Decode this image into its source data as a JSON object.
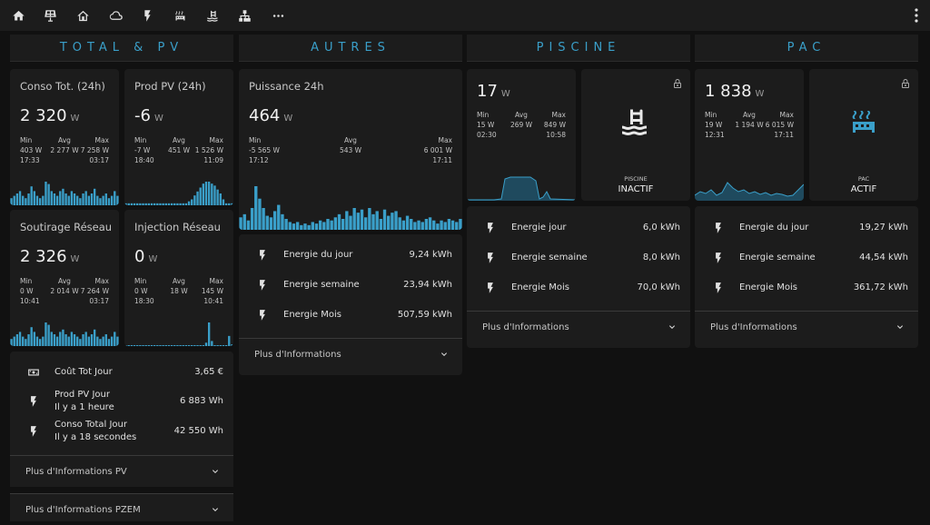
{
  "nav": {
    "icons": [
      "home-icon",
      "solar-panel-icon",
      "home-outline-icon",
      "cloud-icon",
      "flash-icon",
      "heat-pump-icon",
      "pool-icon",
      "network-icon",
      "more-icon"
    ]
  },
  "columns": [
    {
      "title": "TOTAL & PV"
    },
    {
      "title": "AUTRES"
    },
    {
      "title": "PISCINE"
    },
    {
      "title": "PAC"
    }
  ],
  "sensors": {
    "conso_tot": {
      "name": "Conso Tot. (24h)",
      "value": "2 320",
      "unit": "W",
      "min_label": "Min",
      "avg_label": "Avg",
      "max_label": "Max",
      "min": "403 W",
      "avg": "2 277 W",
      "max": "7 258 W",
      "min_time": "17:33",
      "max_time": "03:17"
    },
    "prod_pv": {
      "name": "Prod PV (24h)",
      "value": "-6",
      "unit": "W",
      "min_label": "Min",
      "avg_label": "Avg",
      "max_label": "Max",
      "min": "-7 W",
      "avg": "451 W",
      "max": "1 526 W",
      "min_time": "18:40",
      "max_time": "11:09"
    },
    "soutirage": {
      "name": "Soutirage Réseau",
      "value": "2 326",
      "unit": "W",
      "min_label": "Min",
      "avg_label": "Avg",
      "max_label": "Max",
      "min": "0 W",
      "avg": "2 014 W",
      "max": "7 264 W",
      "min_time": "10:41",
      "max_time": "03:17"
    },
    "injection": {
      "name": "Injection Réseau",
      "value": "0",
      "unit": "W",
      "min_label": "Min",
      "avg_label": "Avg",
      "max_label": "Max",
      "min": "0 W",
      "avg": "18 W",
      "max": "145 W",
      "min_time": "18:30",
      "max_time": "10:41"
    },
    "puissance": {
      "name": "Puissance 24h",
      "value": "464",
      "unit": "W",
      "min_label": "Min",
      "avg_label": "Avg",
      "max_label": "Max",
      "min": "-5 565 W",
      "avg": "543 W",
      "max": "6 001 W",
      "min_time": "17:12",
      "max_time": "17:11"
    },
    "piscine": {
      "value": "17",
      "unit": "W",
      "min_label": "Min",
      "avg_label": "Avg",
      "max_label": "Max",
      "min": "15 W",
      "avg": "269 W",
      "max": "849 W",
      "min_time": "02:30",
      "max_time": "10:58"
    },
    "pac": {
      "value": "1 838",
      "unit": "W",
      "min_label": "Min",
      "avg_label": "Avg",
      "max_label": "Max",
      "min": "19 W",
      "avg": "1 194 W",
      "max": "6 015 W",
      "min_time": "12:31",
      "max_time": "17:11"
    }
  },
  "total_list": {
    "rows": [
      {
        "icon": "cash-icon",
        "label": "Coût Tot Jour",
        "value": "3,65 €"
      },
      {
        "icon": "flash-icon",
        "label": "Prod PV Jour",
        "sub": "Il y a 1 heure",
        "value": "6 883 Wh"
      },
      {
        "icon": "flash-icon",
        "label": "Conso Total Jour",
        "sub": "Il y a 18 secondes",
        "value": "42 550 Wh"
      }
    ],
    "more_pv": "Plus d'Informations PV",
    "more_pzem": "Plus d'Informations PZEM"
  },
  "autres_list": {
    "rows": [
      {
        "label": "Energie du jour",
        "value": "9,24 kWh"
      },
      {
        "label": "Energie semaine",
        "value": "23,94 kWh"
      },
      {
        "label": "Energie Mois",
        "value": "507,59 kWh"
      }
    ],
    "more": "Plus d'Informations"
  },
  "piscine_list": {
    "state_name": "PISCINE",
    "state": "INACTIF",
    "rows": [
      {
        "label": "Energie jour",
        "value": "6,0 kWh"
      },
      {
        "label": "Energie semaine",
        "value": "8,0 kWh"
      },
      {
        "label": "Energie Mois",
        "value": "70,0 kWh"
      }
    ],
    "more": "Plus d'Informations"
  },
  "pac_list": {
    "state_name": "PAC",
    "state": "ACTIF",
    "rows": [
      {
        "label": "Energie du jour",
        "value": "19,27 kWh"
      },
      {
        "label": "Energie semaine",
        "value": "44,54 kWh"
      },
      {
        "label": "Energie Mois",
        "value": "361,72 kWh"
      }
    ],
    "more": "Plus d'Informations"
  },
  "colors": {
    "accent": "#3a9fc9",
    "card": "#1c1c1c",
    "background": "#111111"
  }
}
